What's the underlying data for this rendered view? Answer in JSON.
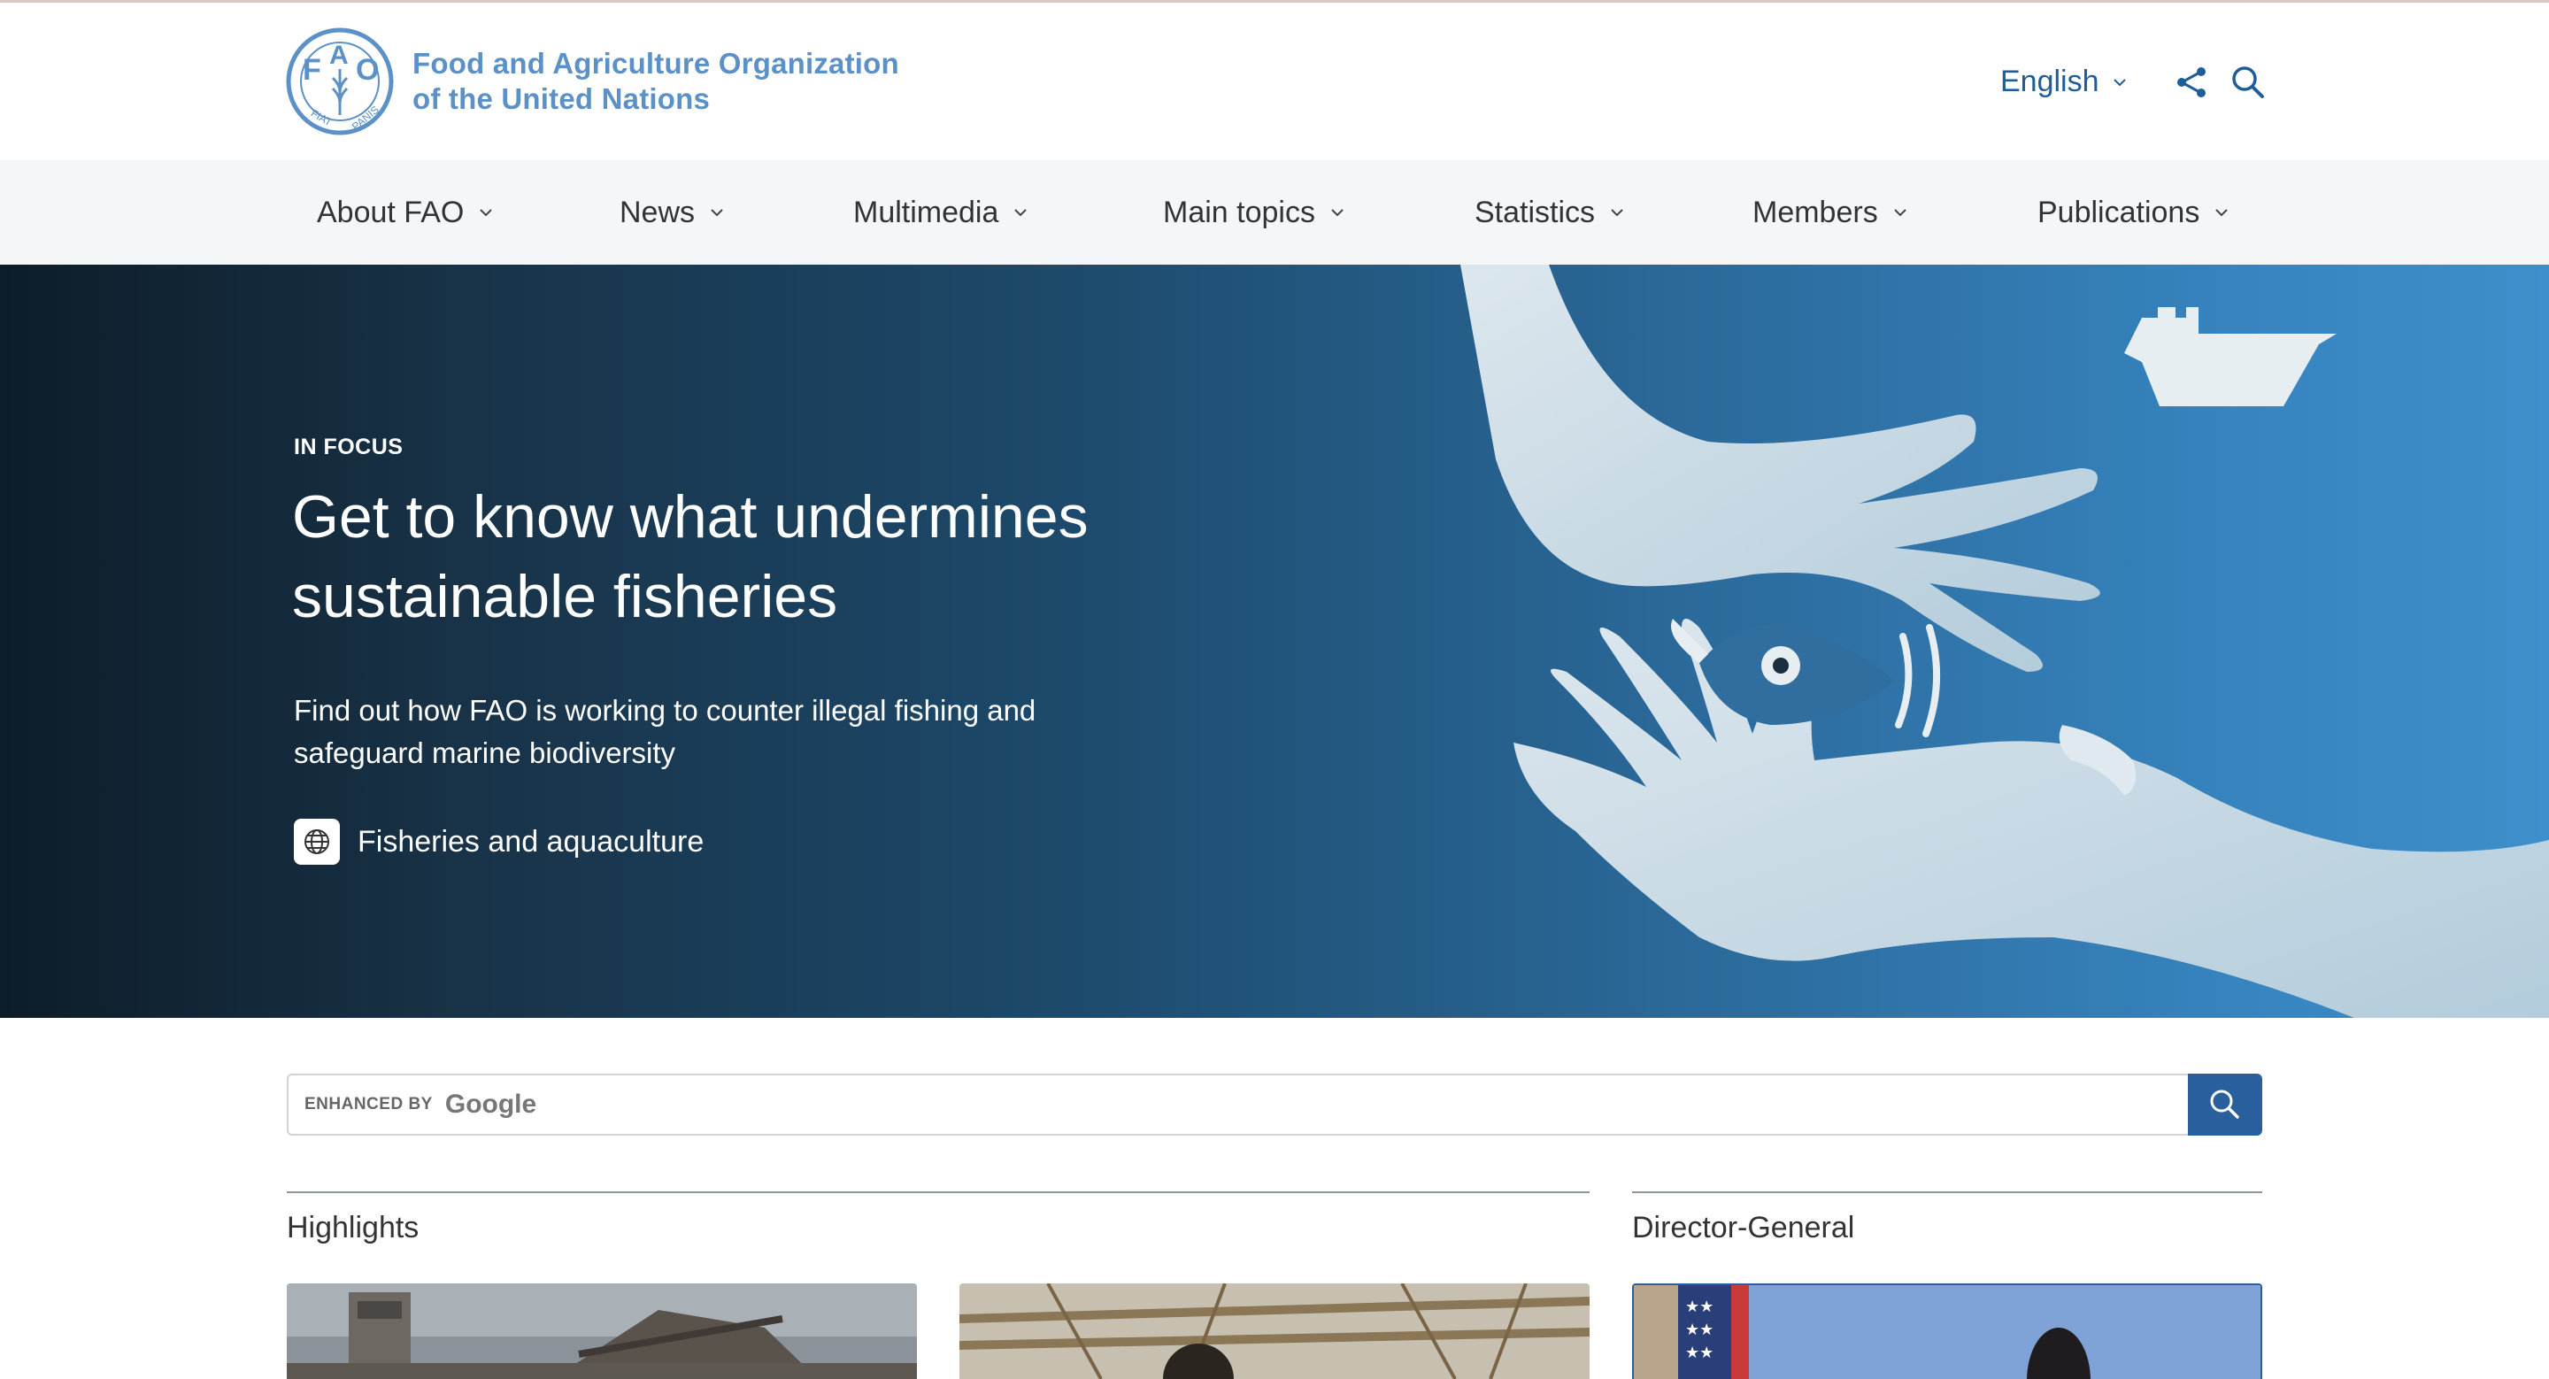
{
  "header": {
    "org_name_line1": "Food and Agriculture Organization",
    "org_name_line2": "of the United Nations",
    "logo_letters": [
      "F",
      "A",
      "O"
    ],
    "logo_motto": "FIAT PANIS",
    "language": "English",
    "icons": {
      "share": "share-icon",
      "search": "search-icon",
      "chevron": "chevron-down-icon"
    }
  },
  "nav": {
    "items": [
      {
        "label": "About FAO"
      },
      {
        "label": "News"
      },
      {
        "label": "Multimedia"
      },
      {
        "label": "Main topics"
      },
      {
        "label": "Statistics"
      },
      {
        "label": "Members"
      },
      {
        "label": "Publications"
      }
    ]
  },
  "hero": {
    "kicker": "IN FOCUS",
    "title": "Get to know what undermines sustainable fisheries",
    "description": "Find out how FAO is working to counter illegal fishing and safeguard marine biodiversity",
    "tag_label": "Fisheries and aquaculture",
    "tag_icon": "globe-icon"
  },
  "search": {
    "enhanced_by": "ENHANCED BY",
    "brand": "Google",
    "button_icon": "search-icon"
  },
  "sections": {
    "highlights": "Highlights",
    "director_general": "Director-General"
  },
  "colors": {
    "brand_blue": "#5b91c6",
    "link_blue": "#1f5d99",
    "button_blue": "#2a5f9e",
    "nav_bg": "#f5f6f8"
  }
}
